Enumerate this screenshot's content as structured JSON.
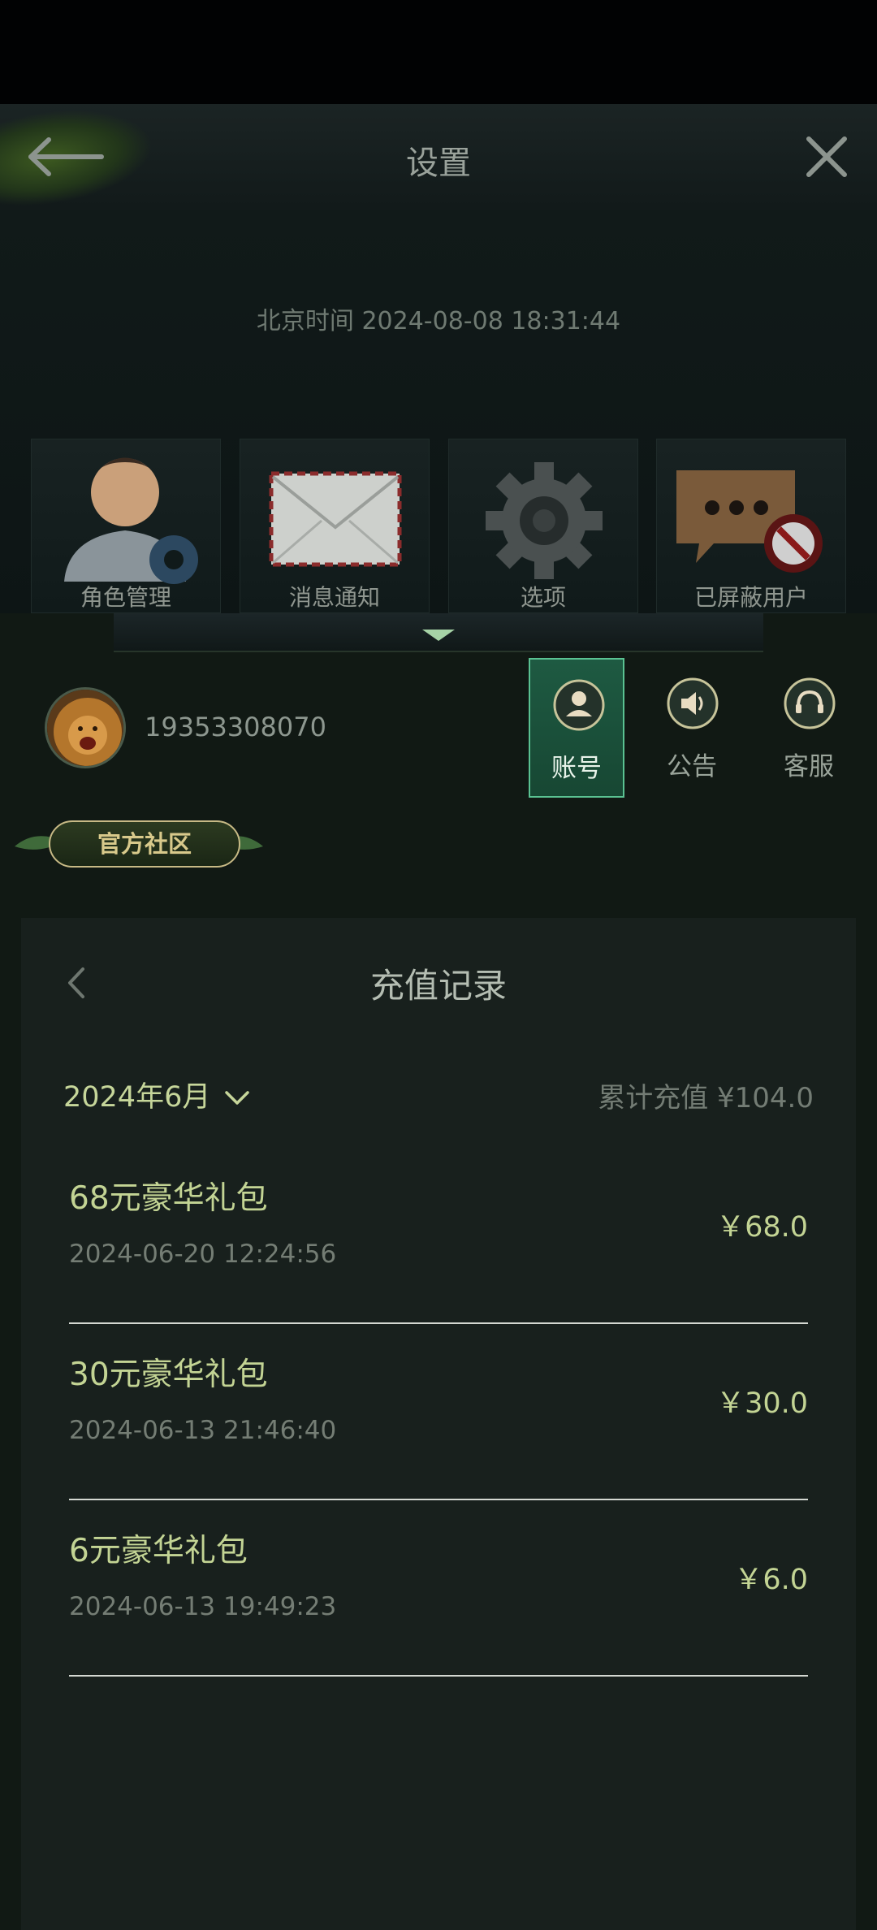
{
  "header": {
    "title": "设置"
  },
  "server_time": "北京时间 2024-08-08 18:31:44",
  "menu_tiles": [
    {
      "label": "角色管理",
      "icon": "role-manage-icon"
    },
    {
      "label": "消息通知",
      "icon": "envelope-icon"
    },
    {
      "label": "选项",
      "icon": "gear-icon"
    },
    {
      "label": "已屏蔽用户",
      "icon": "blocked-chat-icon"
    }
  ],
  "profile": {
    "user_id": "19353308070"
  },
  "tabs": [
    {
      "label": "账号",
      "icon": "user-icon",
      "active": true
    },
    {
      "label": "公告",
      "icon": "speaker-icon",
      "active": false
    },
    {
      "label": "客服",
      "icon": "headset-icon",
      "active": false
    }
  ],
  "community_label": "官方社区",
  "recharge": {
    "title": "充值记录",
    "month": "2024年6月",
    "total_label": "累计充值 ¥104.0",
    "records": [
      {
        "name": "68元豪华礼包",
        "time": "2024-06-20 12:24:56",
        "amount": "￥68.0"
      },
      {
        "name": "30元豪华礼包",
        "time": "2024-06-13 21:46:40",
        "amount": "￥30.0"
      },
      {
        "name": "6元豪华礼包",
        "time": "2024-06-13 19:49:23",
        "amount": "￥6.0"
      }
    ]
  },
  "colors": {
    "accent": "#c3d494",
    "active_tab": "#5ac292",
    "panel": "#18201d"
  }
}
